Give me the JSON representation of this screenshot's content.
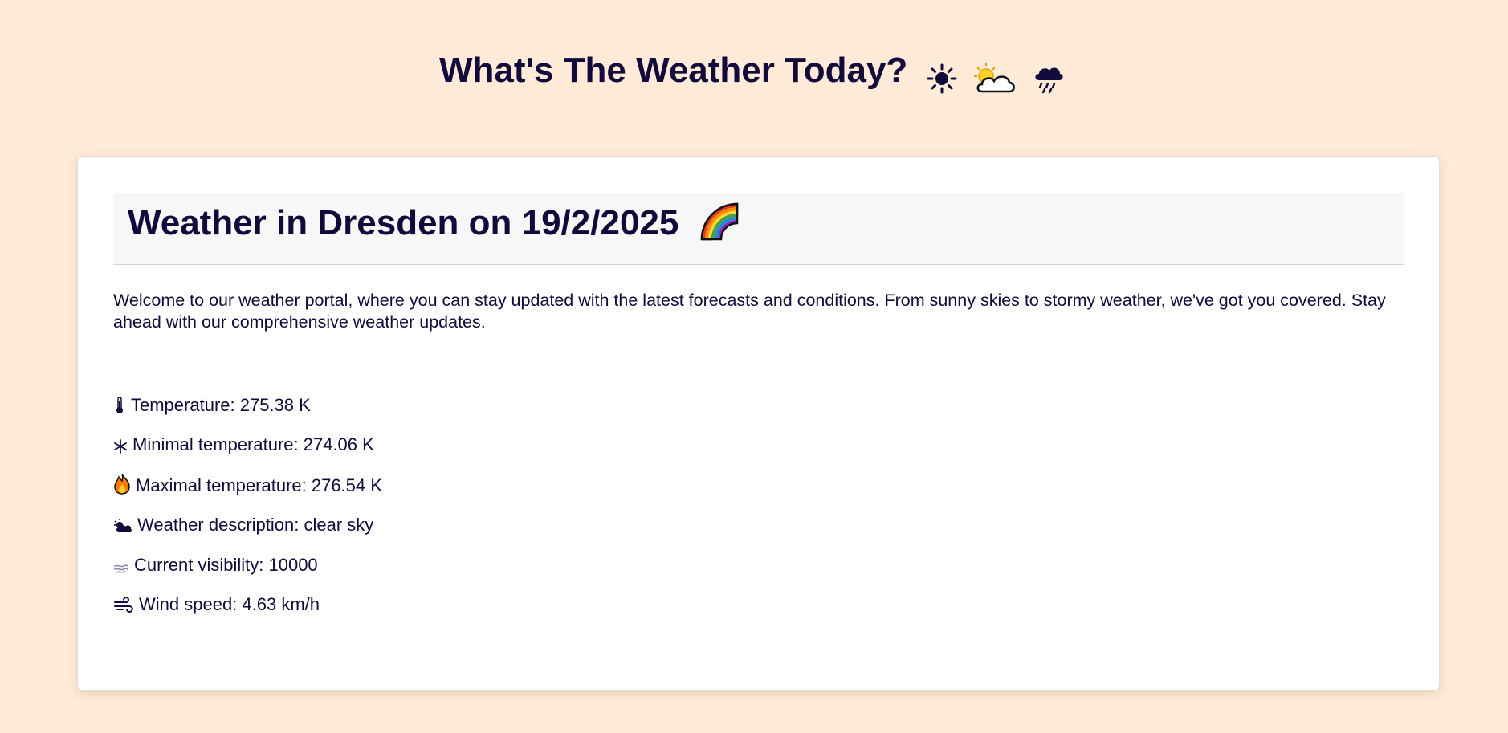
{
  "header": {
    "title": "What's The Weather Today?",
    "icons": [
      "sun-icon",
      "sun-behind-cloud-icon",
      "rain-cloud-icon"
    ]
  },
  "card": {
    "title": "Weather in Dresden on 19/2/2025",
    "title_icon": "rainbow-icon",
    "intro": "Welcome to our weather portal, where you can stay updated with the latest forecasts and conditions. From sunny skies to stormy weather, we've got you covered. Stay ahead with our comprehensive weather updates.",
    "stats": [
      {
        "icon": "thermometer-icon",
        "text": "Temperature: 275.38 K"
      },
      {
        "icon": "snowflake-icon",
        "text": "Minimal temperature: 274.06 K"
      },
      {
        "icon": "fire-icon",
        "text": "Maximal temperature: 276.54 K"
      },
      {
        "icon": "cloud-sun-icon",
        "text": "Weather description: clear sky"
      },
      {
        "icon": "fog-icon",
        "text": "Current visibility: 10000"
      },
      {
        "icon": "wind-icon",
        "text": "Wind speed: 4.63 km/h"
      }
    ]
  },
  "colors": {
    "background": "#FFEBD8",
    "text": "#120A3A",
    "card": "#FFFFFF",
    "card_header": "#F7F7F7"
  }
}
